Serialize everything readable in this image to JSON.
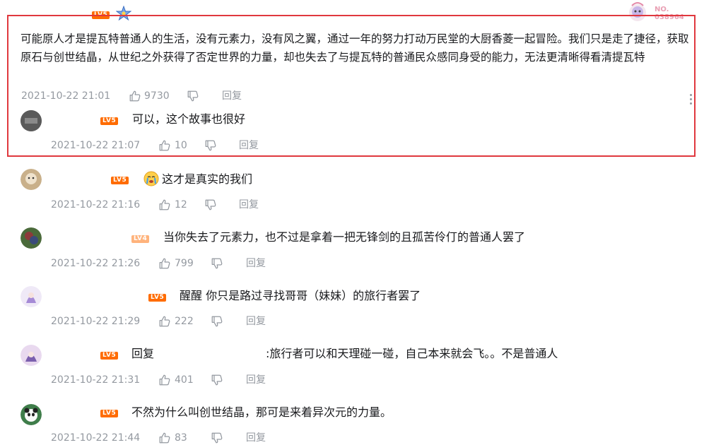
{
  "top": {
    "level_badge": "LV5",
    "no_badge_line1": "NO.",
    "no_badge_line2": "038964"
  },
  "main_comment": {
    "text": "可能原人才是提瓦特普通人的生活，没有元素力，没有风之翼，通过一年的努力打动万民堂的大厨香菱一起冒险。我们只是走了捷径，获取原石与创世结晶，从世纪之外获得了否定世界的力量，却也失去了与提瓦特的普通民众感同身受的能力，无法更清晰得看清提瓦特",
    "time": "2021-10-22 21:01",
    "likes": "9730",
    "reply_label": "回复"
  },
  "replies": [
    {
      "level": "LV5",
      "text": "可以，这个故事也很好",
      "time": "2021-10-22 21:07",
      "likes": "10",
      "reply_label": "回复"
    },
    {
      "level": "LV5",
      "text": "这才是真实的我们",
      "time": "2021-10-22 21:16",
      "likes": "12",
      "reply_label": "回复"
    },
    {
      "level": "LV4",
      "text": "当你失去了元素力，也不过是拿着一把无锋剑的且孤苦伶仃的普通人罢了",
      "time": "2021-10-22 21:26",
      "likes": "799",
      "reply_label": "回复"
    },
    {
      "level": "LV5",
      "text": "醒醒 你只是路过寻找哥哥（妹妹）的旅行者罢了",
      "time": "2021-10-22 21:29",
      "likes": "222",
      "reply_label": "回复"
    },
    {
      "level": "LV5",
      "prefix": "回复",
      "text": ":旅行者可以和天理碰一碰，自己本来就会飞。。不是普通人",
      "time": "2021-10-22 21:31",
      "likes": "401",
      "reply_label": "回复"
    },
    {
      "level": "LV5",
      "text": "不然为什么叫创世结晶，那可是来着异次元的力量。",
      "time": "2021-10-22 21:44",
      "likes": "83",
      "reply_label": "回复"
    }
  ],
  "colors": {
    "highlight_border": "#e0383e",
    "level5": "#ff6c00",
    "level4": "#ffb37c",
    "meta_text": "#9499a0",
    "body_text": "#18191c"
  },
  "icons": [
    "thumbs-up-icon",
    "thumbs-down-icon",
    "more-vertical-icon",
    "star-badge-icon",
    "crying-emoji-icon"
  ]
}
